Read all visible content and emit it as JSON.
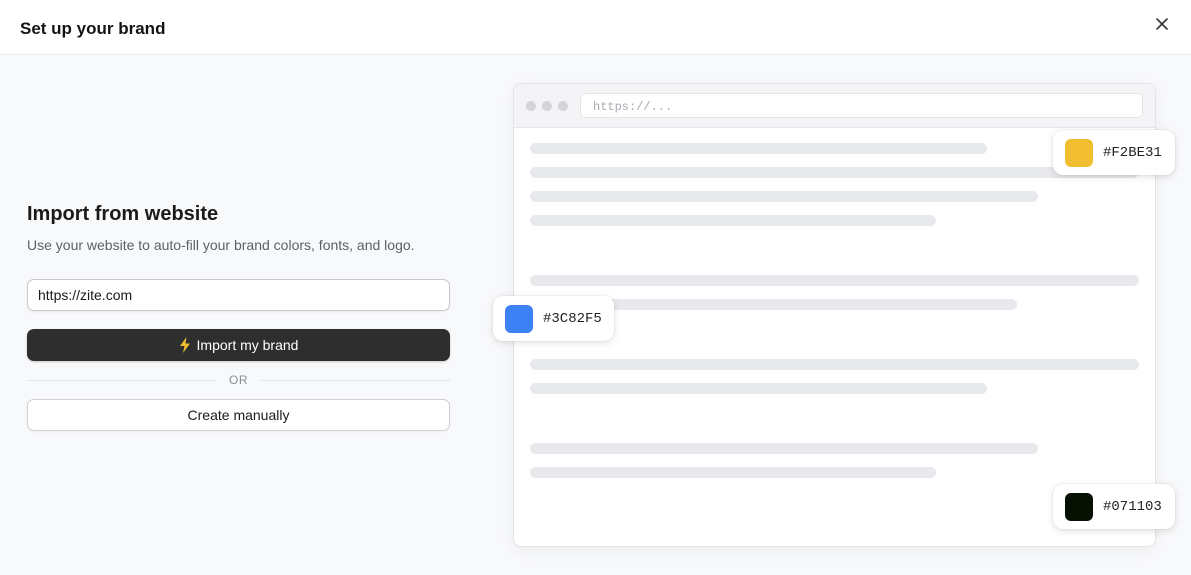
{
  "dialog": {
    "title": "Set up your brand",
    "close_icon": "close-icon"
  },
  "import": {
    "heading": "Import from website",
    "subtitle": "Use your website to auto-fill your brand colors, fonts, and logo.",
    "url_value": "https://zite.com",
    "import_button_label": "Import my brand",
    "import_button_icon": "lightning-bolt-icon",
    "or_label": "OR",
    "manual_button_label": "Create manually"
  },
  "preview": {
    "address_placeholder": "https://...",
    "colors": [
      {
        "hex": "#F2BE31",
        "swatch": "#F2BE31"
      },
      {
        "hex": "#3C82F5",
        "swatch": "#3C82F5"
      },
      {
        "hex": "#071103",
        "swatch": "#071103"
      }
    ]
  },
  "theme": {
    "primary_button_bg": "#2e2e2e",
    "accent_yellow": "#F2BE31"
  }
}
